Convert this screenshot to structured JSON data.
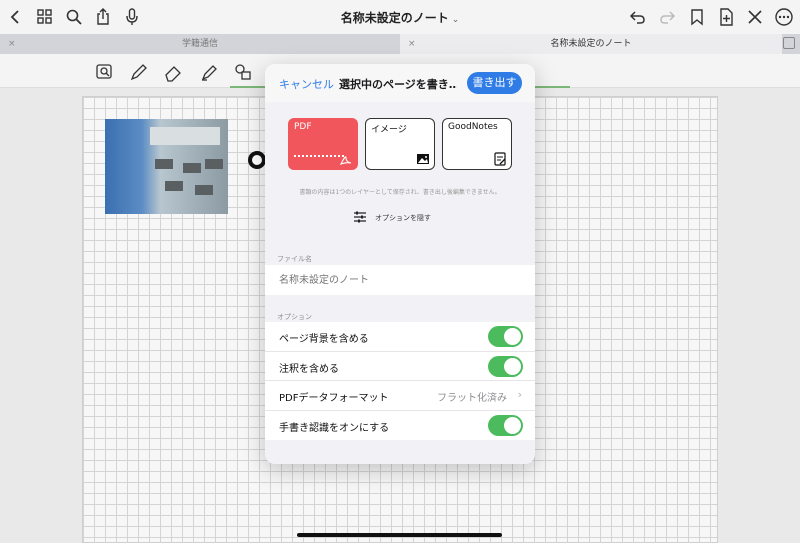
{
  "topbar": {
    "title": "名称未設定のノート",
    "title_chevron": "⌄",
    "left_icons": [
      "back-chevron-icon",
      "grid-icon",
      "search-icon",
      "share-icon",
      "microphone-icon"
    ],
    "right_icons": [
      "undo-icon",
      "redo-icon",
      "bookmark-icon",
      "add-page-icon",
      "close-icon",
      "more-icon"
    ]
  },
  "tabs": [
    {
      "label": "学籍通信",
      "close": "×"
    },
    {
      "label": "名称未設定のノート",
      "close": "×"
    }
  ],
  "toolbar": {
    "tools": [
      "lasso-zoom-icon",
      "pen-icon",
      "eraser-icon",
      "highlighter-icon",
      "shapes-icon",
      "image-icon"
    ]
  },
  "export": {
    "cancel_label": "キャンセル",
    "title": "選択中のページを書き…",
    "export_label": "書き出す",
    "formats": [
      {
        "label": "PDF",
        "selected": true
      },
      {
        "label": "イメージ",
        "selected": false
      },
      {
        "label": "GoodNotes",
        "selected": false
      }
    ],
    "note": "書類の内容は1つのレイヤーとして保存され、書き出し後編集できません。",
    "options_toggle_label": "オプションを隠す",
    "filename_section": "ファイル名",
    "filename_placeholder": "名称未設定のノート",
    "options_section": "オプション",
    "options": [
      {
        "label": "ページ背景を含める",
        "type": "toggle",
        "on": true
      },
      {
        "label": "注釈を含める",
        "type": "toggle",
        "on": true
      },
      {
        "label": "PDFデータフォーマット",
        "type": "select",
        "value": "フラット化済み",
        "chevron": "›"
      },
      {
        "label": "手書き認識をオンにする",
        "type": "toggle",
        "on": true
      }
    ],
    "accent_color": "#2f7ce6",
    "toggle_color": "#4cbb5e",
    "pdf_color": "#f0565b"
  }
}
